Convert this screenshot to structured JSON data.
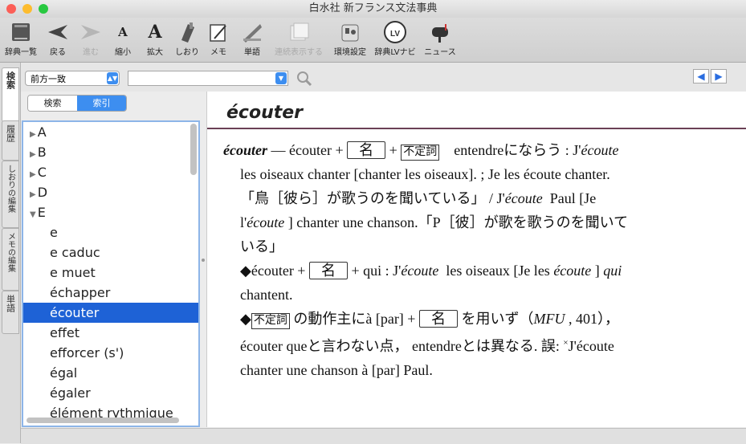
{
  "window": {
    "title": "白水社 新フランス文法事典"
  },
  "toolbar": [
    {
      "label": "辞典一覧",
      "icon": "books-icon",
      "enabled": true
    },
    {
      "label": "戻る",
      "icon": "back-arrow-icon",
      "enabled": true
    },
    {
      "label": "進む",
      "icon": "forward-arrow-icon",
      "enabled": false
    },
    {
      "label": "縮小",
      "icon": "font-smaller-icon",
      "enabled": true
    },
    {
      "label": "拡大",
      "icon": "font-larger-icon",
      "enabled": true
    },
    {
      "label": "しおり",
      "icon": "bookmark-icon",
      "enabled": true
    },
    {
      "label": "メモ",
      "icon": "memo-icon",
      "enabled": true
    },
    {
      "label": "単語",
      "icon": "word-icon",
      "enabled": true
    },
    {
      "label": "連続表示する",
      "icon": "continuous-display-icon",
      "enabled": false
    },
    {
      "label": "環境設定",
      "icon": "settings-icon",
      "enabled": true
    },
    {
      "label": "辞典LVナビ",
      "icon": "lv-navi-icon",
      "enabled": true
    },
    {
      "label": "ニュース",
      "icon": "mailbox-icon",
      "enabled": true
    }
  ],
  "sidetabs": {
    "search": "検索",
    "history": "履歴",
    "bookmarks": "しおりの編集",
    "memo": "メモの編集",
    "words": "単語"
  },
  "search": {
    "mode": "前方一致",
    "query": "",
    "seg_search": "検索",
    "seg_index": "索引"
  },
  "index_list": [
    {
      "text": "A",
      "type": "group",
      "open": false
    },
    {
      "text": "B",
      "type": "group",
      "open": false
    },
    {
      "text": "C",
      "type": "group",
      "open": false
    },
    {
      "text": "D",
      "type": "group",
      "open": false
    },
    {
      "text": "E",
      "type": "group",
      "open": true
    },
    {
      "text": "e",
      "type": "item"
    },
    {
      "text": "e caduc",
      "type": "item"
    },
    {
      "text": "e muet",
      "type": "item"
    },
    {
      "text": "échapper",
      "type": "item"
    },
    {
      "text": "écouter",
      "type": "item",
      "selected": true
    },
    {
      "text": "effet",
      "type": "item"
    },
    {
      "text": "efforcer (s')",
      "type": "item"
    },
    {
      "text": "égal",
      "type": "item"
    },
    {
      "text": "égaler",
      "type": "item"
    },
    {
      "text": "élément rythmique",
      "type": "item"
    }
  ],
  "entry": {
    "headword": "écouter",
    "line1_hw": "écouter",
    "line1_a": "— écouter +",
    "box_noun": "名",
    "plus": "+",
    "box_inf": "不定詞",
    "line1_b": "entendreにならう :",
    "j1": "J'",
    "ecoute": "écoute",
    "line2": "les oiseaux chanter [chanter les oiseaux]. ; Je les écoute chanter.",
    "line3": "「鳥［彼ら］が歌うのを聞いている」 /",
    "line3_j": "J'",
    "line3_b": "Paul [Je",
    "line4_a": "l'",
    "line4_b": "] chanter une chanson.「P［彼］が歌を歌うのを聞いて",
    "line5": "いる」",
    "diamond": "◆",
    "line6_a": "écouter +",
    "line6_b": "+ qui :",
    "line6_j": "J'",
    "line6_c": "les oiseaux [Je les",
    "line6_d": "]",
    "qui": "qui",
    "line7": "chantent.",
    "line8_b": "の動作主にà [par] +",
    "line8_c": "を用いず（",
    "mfu": "MFU",
    "line8_d": ", 401），",
    "line9": "écouter queと言わない点，  entendreとは異なる. 誤: ",
    "cross": "×",
    "line9_b": "J'écoute",
    "line10": "chanter une chanson à [par] Paul."
  }
}
